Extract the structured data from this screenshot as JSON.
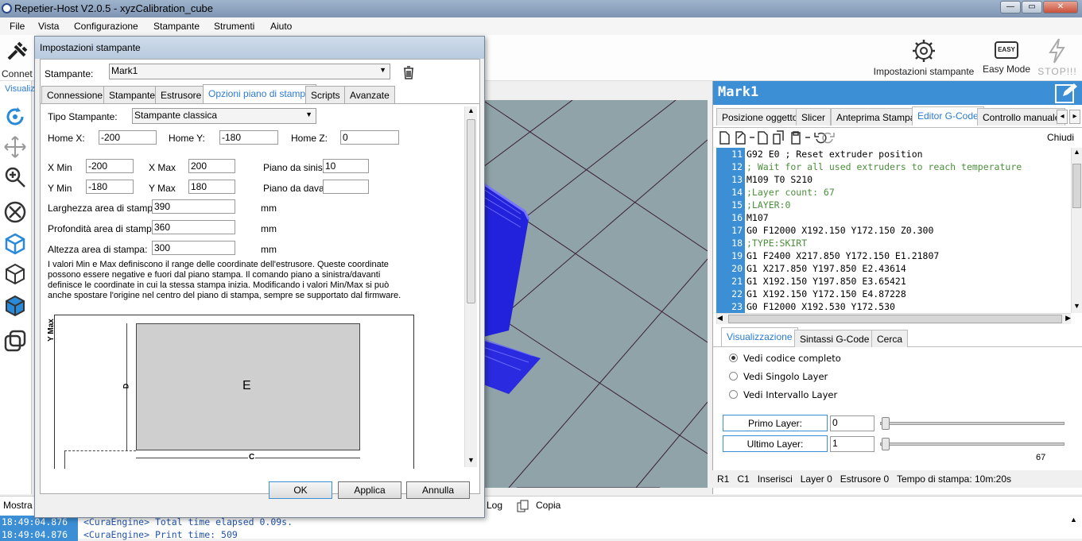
{
  "window": {
    "title": "Repetier-Host V2.0.5 - xyzCalibration_cube",
    "controls": {
      "minimize": "—",
      "maximize": "▭",
      "close": "✕"
    }
  },
  "menu": [
    "File",
    "Vista",
    "Configurazione",
    "Stampante",
    "Strumenti",
    "Aiuto"
  ],
  "toolbar": {
    "connect_label": "Connet",
    "settings_label": "Impostazioni stampante",
    "easy_icon_text": "EASY",
    "easy_label": "Easy Mode",
    "stop_label": "STOP!!!"
  },
  "left_tab_partial": "Visualiz",
  "right": {
    "printer_name": "Mark1",
    "tabs": [
      "Posizione oggetto",
      "Slicer",
      "Anteprima Stampa",
      "Editor G-Code",
      "Controllo manuale"
    ],
    "active_tab": "Editor G-Code",
    "close_label": "Chiudi",
    "code": [
      {
        "n": "11",
        "t": "G92 E0 ; Reset extruder position",
        "kind": "cmd"
      },
      {
        "n": "12",
        "t": "; Wait for all used extruders to reach temperature",
        "kind": "comment"
      },
      {
        "n": "13",
        "t": "M109 T0 S210",
        "kind": "cmd"
      },
      {
        "n": "14",
        "t": ";Layer count: 67",
        "kind": "comment"
      },
      {
        "n": "15",
        "t": ";LAYER:0",
        "kind": "comment"
      },
      {
        "n": "16",
        "t": "M107",
        "kind": "cmd"
      },
      {
        "n": "17",
        "t": "G0 F12000 X192.150 Y172.150 Z0.300",
        "kind": "cmd"
      },
      {
        "n": "18",
        "t": ";TYPE:SKIRT",
        "kind": "comment"
      },
      {
        "n": "19",
        "t": "G1 F2400 X217.850 Y172.150 E1.21807",
        "kind": "cmd"
      },
      {
        "n": "20",
        "t": "G1 X217.850 Y197.850 E2.43614",
        "kind": "cmd"
      },
      {
        "n": "21",
        "t": "G1 X192.150 Y197.850 E3.65421",
        "kind": "cmd"
      },
      {
        "n": "22",
        "t": "G1 X192.150 Y172.150 E4.87228",
        "kind": "cmd"
      },
      {
        "n": "23",
        "t": "G0 F12000 X192.530 Y172.530",
        "kind": "cmd"
      }
    ],
    "lower_tabs": [
      "Visualizzazione",
      "Sintassi G-Code",
      "Cerca"
    ],
    "view_options": [
      "Vedi codice completo",
      "Vedi Singolo Layer",
      "Vedi Intervallo Layer"
    ],
    "first_layer_label": "Primo Layer:",
    "first_layer_value": "0",
    "last_layer_label": "Ultimo Layer:",
    "last_layer_value": "1",
    "layer_max": "67",
    "status": [
      "R1",
      "C1",
      "Inserisci",
      "Layer 0",
      "Estrusore 0",
      "Tempo di stampa: 10m:20s"
    ]
  },
  "console": {
    "left_partial": "Mostra n",
    "log_label": "Log",
    "copy_label": "Copia",
    "lines": [
      {
        "time": "18:49:04.876",
        "msg": "<CuraEngine> Total time elapsed  0.09s."
      },
      {
        "time": "18:49:04.876",
        "msg": "<CuraEngine> Print time: 509"
      }
    ]
  },
  "dialog": {
    "title": "Impostazioni stampante",
    "printer_label": "Stampante:",
    "printer_value": "Mark1",
    "tabs": [
      "Connessione",
      "Stampante",
      "Estrusore",
      "Opzioni piano di stampa",
      "Scripts",
      "Avanzate"
    ],
    "active_tab": "Opzioni piano di stampa",
    "type_label": "Tipo Stampante:",
    "type_value": "Stampante classica",
    "home_x_label": "Home X:",
    "home_x": "-200",
    "home_y_label": "Home Y:",
    "home_y": "-180",
    "home_z_label": "Home Z:",
    "home_z": "0",
    "xmin_label": "X Min",
    "xmin": "-200",
    "xmax_label": "X Max",
    "xmax": "200",
    "left_bed_label": "Piano da sinistra",
    "left_bed": "10",
    "ymin_label": "Y Min",
    "ymin": "-180",
    "ymax_label": "Y Max",
    "ymax": "180",
    "front_bed_label": "Piano da davanti:",
    "front_bed": "",
    "width_label": "Larghezza area di stampa:",
    "width": "390",
    "depth_label": "Profondità area di stampa:",
    "depth": "360",
    "height_label": "Altezza area di stampa:",
    "height": "300",
    "unit": "mm",
    "description": "I valori Min e Max definiscono il range delle coordinate dell'estrusore. Queste coordinate possono essere negative e fuori dal piano stampa. Il comando piano a sinistra/davanti definisce le coordinate in cui la stessa stampa inizia. Modificando i valori Min/Max si può anche spostare l'origine nel centro del piano di stampa, sempre se supportato dal firmware.",
    "diagram": {
      "ymax_label": "Y Max",
      "d_label": "D",
      "e_label": "E",
      "c_label": "C"
    },
    "ok": "OK",
    "apply": "Applica",
    "cancel": "Annulla"
  },
  "colors": {
    "accent": "#3c8fd5",
    "model": "#2222dd",
    "floor": "#8fa3a8"
  }
}
